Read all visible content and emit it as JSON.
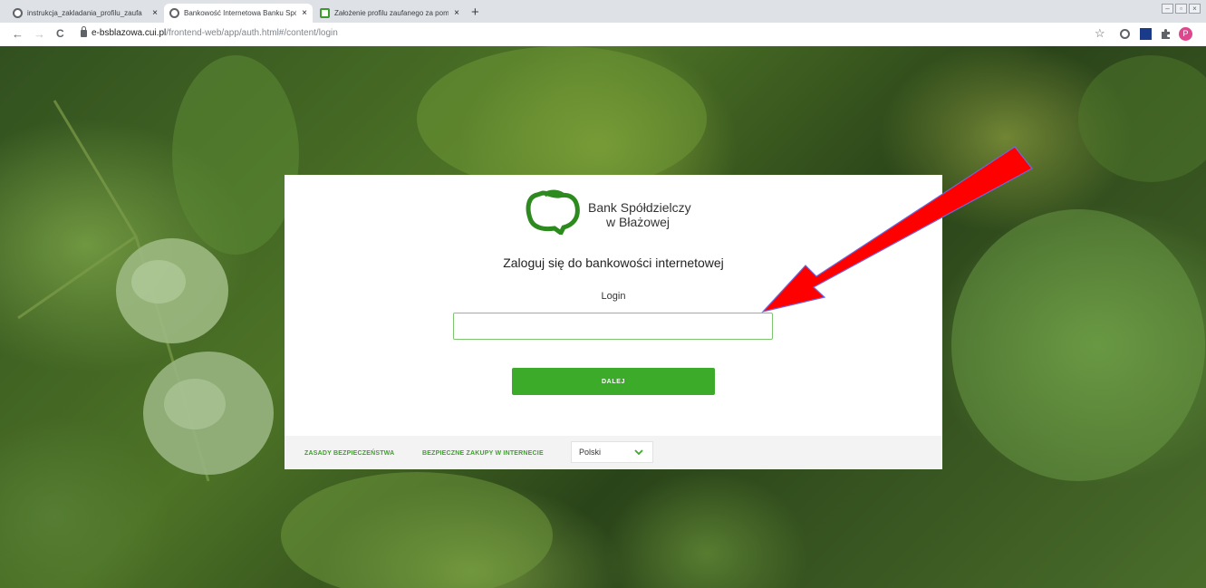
{
  "browser": {
    "tabs": [
      {
        "title": "instrukcja_zakladania_profilu_zaufa",
        "close": "×",
        "active": false,
        "icon": "globe-icon"
      },
      {
        "title": "Bankowość Internetowa Banku Spó",
        "close": "×",
        "active": true,
        "icon": "globe-icon"
      },
      {
        "title": "Założenie profilu zaufanego za pomo",
        "close": "×",
        "active": false,
        "icon": "profile-zaufany-icon"
      }
    ],
    "new_tab": "+",
    "back": "←",
    "forward": "→",
    "reload": "C",
    "url_host": "e-bsblazowa.cui.pl",
    "url_path": "/frontend-web/app/auth.html#/content/login",
    "bookmark": "☆",
    "profile_initial": "P"
  },
  "card": {
    "bank_name_line1": "Bank Spółdzielczy",
    "bank_name_line2": "w Błażowej",
    "heading": "Zaloguj się do bankowości internetowej",
    "login_label": "Login",
    "login_value": "",
    "next_label": "DALEJ"
  },
  "footer": {
    "security_link": "ZASADY BEZPIECZEŃSTWA",
    "shopping_link": "BEZPIECZNE ZAKUPY W INTERNECIE",
    "language": "Polski"
  },
  "colors": {
    "brand_green": "#3dab2a",
    "arrow_red": "#ff0000"
  }
}
